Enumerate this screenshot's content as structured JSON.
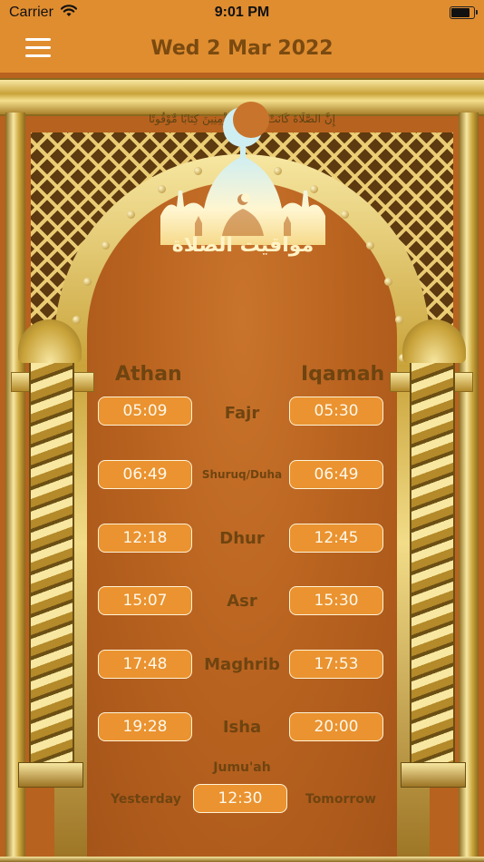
{
  "status_bar": {
    "carrier": "Carrier",
    "time": "9:01 PM",
    "battery_level": 0.95
  },
  "nav": {
    "title": "Wed 2 Mar 2022",
    "menu_icon": "hamburger-menu-icon"
  },
  "decor": {
    "verse": "إِنَّ الصَّلَاةَ كَانَتْ عَلَى الْمُؤْمِنِينَ كِتَابًا مَّوْقُوتًا",
    "emblem_title": "مواقيت الصلاة",
    "emblem_icon": "mosque-crescent-icon"
  },
  "table": {
    "athan_header": "Athan",
    "iqamah_header": "Iqamah",
    "prayers": [
      {
        "name": "Fajr",
        "athan": "05:09",
        "iqamah": "05:30"
      },
      {
        "name": "Shuruq/Duha",
        "athan": "06:49",
        "iqamah": "06:49"
      },
      {
        "name": "Dhur",
        "athan": "12:18",
        "iqamah": "12:45"
      },
      {
        "name": "Asr",
        "athan": "15:07",
        "iqamah": "15:30"
      },
      {
        "name": "Maghrib",
        "athan": "17:48",
        "iqamah": "17:53"
      },
      {
        "name": "Isha",
        "athan": "19:28",
        "iqamah": "20:00"
      }
    ],
    "jumuah": {
      "label": "Jumu'ah",
      "time": "12:30",
      "yesterday": "Yesterday",
      "tomorrow": "Tomorrow"
    }
  },
  "colors": {
    "accent": "#e08d30",
    "button": "#ea9330",
    "text_brown": "#6f4410",
    "background": "#b8621f"
  }
}
